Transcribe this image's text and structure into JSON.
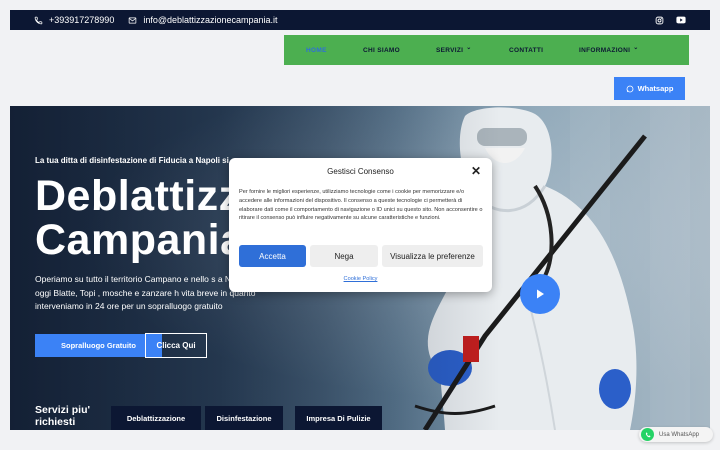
{
  "topbar": {
    "phone": "+393917278990",
    "email": "info@deblattizzazionecampania.it",
    "social_icons": [
      "instagram-icon",
      "youtube-icon"
    ]
  },
  "nav": {
    "items": [
      {
        "label": "HOME",
        "active": true,
        "has_dropdown": false
      },
      {
        "label": "CHI SIAMO",
        "active": false,
        "has_dropdown": false
      },
      {
        "label": "SERVIZI",
        "active": false,
        "has_dropdown": true
      },
      {
        "label": "CONTATTI",
        "active": false,
        "has_dropdown": false
      },
      {
        "label": "INFORMAZIONI",
        "active": false,
        "has_dropdown": true
      }
    ]
  },
  "whatsapp_button": {
    "label": "Whatsapp",
    "icon": "whatsapp-icon"
  },
  "hero": {
    "tagline": "La tua ditta di disinfestazione di Fiducia a Napoli si o",
    "heading_line1": "Deblattizza",
    "heading_line2": "Campania",
    "description": "Operiamo su tutto il territorio Campano e nello s a Napoli da oggi Blatte, Topi , mosche e zanzare h vita breve in quanto interveniamo in 24 ore per un sopralluogo gratuito",
    "primary_button": "Sopralluogo Gratuito",
    "secondary_button": "Clicca Qui",
    "play_icon": "play-icon"
  },
  "services": {
    "title": "Servizi piu' richiesti",
    "items": [
      "Deblattizzazione",
      "Disinfestazione",
      "Impresa Di Pulizie"
    ]
  },
  "cookie_modal": {
    "title": "Gestisci Consenso",
    "text": "Per fornire le migliori esperienze, utilizziamo tecnologie come i cookie per memorizzare e/o accedere alle informazioni del dispositivo. Il consenso a queste tecnologie ci permetterà di elaborare dati come il comportamento di navigazione o ID unici su questo sito. Non acconsentire o ritirare il consenso può influire negativamente su alcune caratteristiche e funzioni.",
    "accept": "Accetta",
    "deny": "Nega",
    "preferences": "Visualizza le preferenze",
    "policy_link": "Cookie Policy"
  },
  "floating_whatsapp": {
    "label": "Usa WhatsApp"
  },
  "colors": {
    "navy": "#0c1733",
    "accent_blue": "#3b82f6",
    "nav_green": "#4caf50",
    "active_nav": "#2f6fd8"
  }
}
